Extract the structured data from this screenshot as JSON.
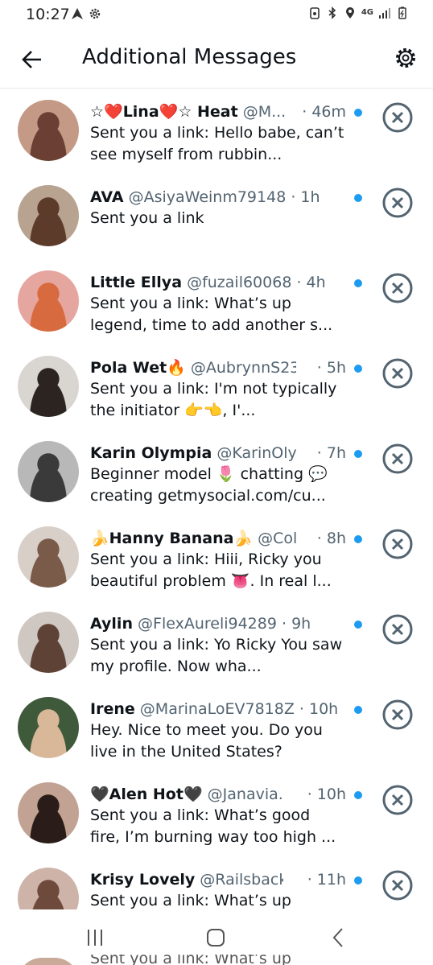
{
  "status_bar": {
    "time": "10:27",
    "network": "4G"
  },
  "header": {
    "title": "Additional Messages"
  },
  "messages": [
    {
      "name": "☆❤️Lina❤️☆ Heat",
      "handle": "@M...",
      "time": "· 46m",
      "text": "Sent you a link: Hello babe, can’t see myself from rubbin...",
      "avatar_bg": "#c49a86",
      "avatar_fg": "#6b3f33"
    },
    {
      "name": "AVA",
      "handle": "@AsiyaWeinm79148 ·",
      "time": "1h",
      "text": "Sent you a link",
      "avatar_bg": "#b7a390",
      "avatar_fg": "#5c3b2a"
    },
    {
      "name": "Little Ellya",
      "handle": "@fuzail60068 ·",
      "time": "4h",
      "text": "Sent you a link: What’s up legend, time to add another s...",
      "avatar_bg": "#e6a6a0",
      "avatar_fg": "#d86a3f"
    },
    {
      "name": "Pola Wet🔥",
      "handle": "@AubrynnS23...",
      "time": "· 5h",
      "text": "Sent you a link: I'm not typically the initiator 👉👈, I'...",
      "avatar_bg": "#d9d6d2",
      "avatar_fg": "#2b2420"
    },
    {
      "name": "Karin Olympia",
      "handle": "@KarinOly...",
      "time": "· 7h",
      "text": "Beginner model 🌷 chatting 💬 creating getmysocial.com/cu...",
      "avatar_bg": "#b8b8b8",
      "avatar_fg": "#3a3a3a"
    },
    {
      "name": "🍌Hanny Banana🍌",
      "handle": "@Col...",
      "time": "· 8h",
      "text": "Sent you a link: Hiii, Ricky you beautiful problem 👅. In real l...",
      "avatar_bg": "#d8cfc8",
      "avatar_fg": "#7a5a48"
    },
    {
      "name": "Aylin",
      "handle": "@FlexAureli94289 ·",
      "time": "9h",
      "text": "Sent you a link: Yo Ricky You saw my profile. Now wha...",
      "avatar_bg": "#cfc7c2",
      "avatar_fg": "#5e4236"
    },
    {
      "name": "Irene",
      "handle": "@MarinaLoEV7818Z ·",
      "time": "10h",
      "text": "Hey. Nice to meet you. Do you live in the United States?",
      "avatar_bg": "#3f5a3a",
      "avatar_fg": "#d9b89a"
    },
    {
      "name": "🖤Alen Hot🖤",
      "handle": "@Janavia...",
      "time": "· 10h",
      "text": "Sent you a link: What’s good fire, I’m burning way too high ...",
      "avatar_bg": "#c2a393",
      "avatar_fg": "#2a1c18"
    },
    {
      "name": "Krisy Lovely",
      "handle": "@RailsbackT...",
      "time": "· 11h",
      "text": "Sent you a link: What’s up",
      "avatar_bg": "#cdb3a8",
      "avatar_fg": "#6d4a3c"
    }
  ],
  "peek_text": "Sent you a link: What’s up",
  "colors": {
    "accent": "#1d9bf0",
    "text": "#0f1419",
    "secondary": "#536471"
  }
}
